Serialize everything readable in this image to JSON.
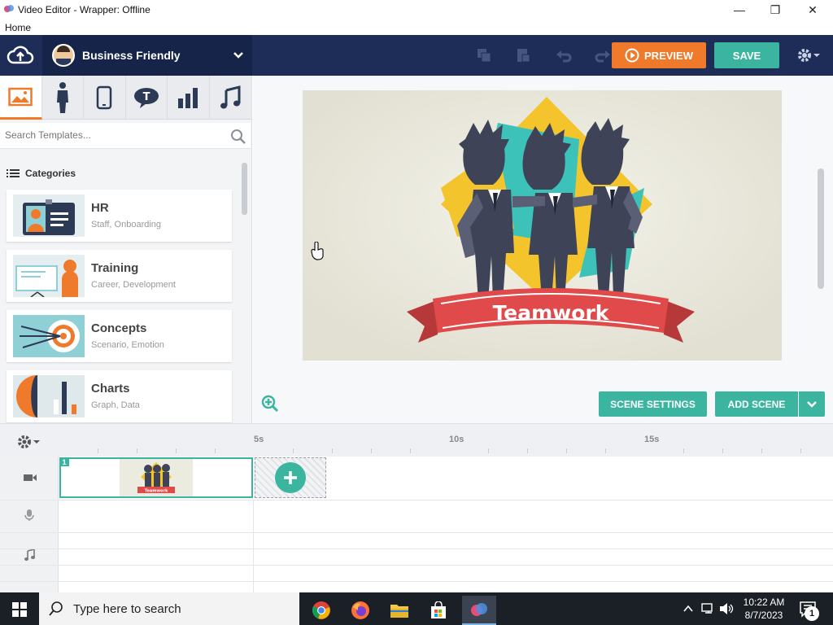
{
  "window": {
    "title": "Video Editor - Wrapper: Offline",
    "menu_home": "Home",
    "minimize": "—",
    "restore": "❐",
    "close": "✕"
  },
  "toolbar": {
    "theme_label": "Business Friendly",
    "preview_label": "PREVIEW",
    "save_label": "SAVE"
  },
  "left_panel": {
    "tabs": [
      "image",
      "character",
      "prop",
      "bubble",
      "chart",
      "music"
    ],
    "search_placeholder": "Search Templates...",
    "categories_label": "Categories",
    "categories": [
      {
        "title": "HR",
        "subtitle": "Staff, Onboarding"
      },
      {
        "title": "Training",
        "subtitle": "Career, Development"
      },
      {
        "title": "Concepts",
        "subtitle": "Scenario, Emotion"
      },
      {
        "title": "Charts",
        "subtitle": "Graph, Data"
      }
    ]
  },
  "stage": {
    "banner_text": "Teamwork",
    "scene_settings_label": "SCENE SETTINGS",
    "add_scene_label": "ADD SCENE"
  },
  "timeline": {
    "markers": [
      "5s",
      "10s",
      "15s"
    ],
    "scene_number": "1",
    "thumb_banner": "Teamwork"
  },
  "taskbar": {
    "search_placeholder": "Type here to search",
    "time": "10:22 AM",
    "date": "8/7/2023",
    "notifications": "1"
  },
  "colors": {
    "navy": "#1e2d57",
    "orange": "#f07a2b",
    "teal": "#3cb5a0",
    "banner_red": "#e04a4a"
  }
}
